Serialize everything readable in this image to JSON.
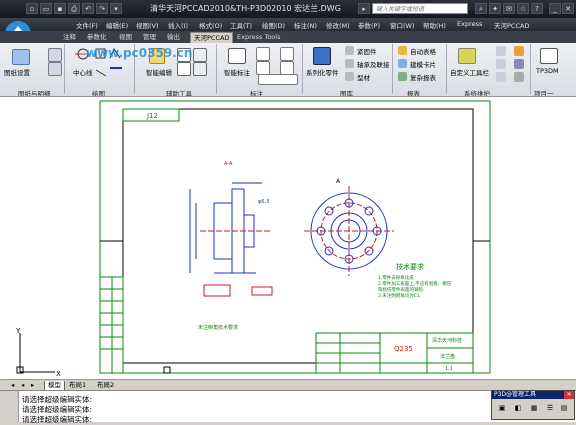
{
  "app": {
    "title": "清华天河PCCAD2010&TH-P3D02010  宏达兰.DWG",
    "search_placeholder": "键入关键字或短语"
  },
  "menus": [
    "文件(F)",
    "编辑(E)",
    "视图(V)",
    "插入(I)",
    "格式(O)",
    "工具(T)",
    "绘图(D)",
    "标注(N)",
    "修改(M)",
    "参数(P)",
    "窗口(W)",
    "帮助(H)",
    "Express",
    "天河PCCAD"
  ],
  "ribbon_tabs": [
    "注释",
    "参数化",
    "视图",
    "管理",
    "输出",
    "天河PCCAD",
    "Express Tools"
  ],
  "ribbon": {
    "tuzhi_btn": "图纸设置",
    "zhongxinxian_btn": "中心线",
    "zhineng_edit_btn": "智能编辑",
    "zhineng_dim_btn": "智能标注",
    "xilie_btn": "系列化零件",
    "gujian_label": "紧固件",
    "zhoucheng_label": "轴承及联接",
    "xingcai_label": "型材",
    "zidong_biaoge": "自动表格",
    "zhuangtu_kapian": "建模卡片",
    "fuza_biaoge": "复杂报表",
    "zidingyi_btn": "自定义工具栏",
    "tp3dm_btn": "TP3DM",
    "panels": [
      "图纸与明细",
      "绘图",
      "辅助工具",
      "标注",
      "图库",
      "报表",
      "系统维护",
      "项目一"
    ]
  },
  "watermark": "www.pc0359.cn",
  "drawing": {
    "title_code": "J12",
    "material": "Q235",
    "section_a": "A-A",
    "dim_1": "φ6.3",
    "tech_req_title": "技术要求",
    "tech_lines": [
      "1.零件去除氧化皮.",
      "2.零件加工表面上,不应有划痕、擦伤",
      "等损伤零件表面的缺陷.",
      "3.未注明倒角均为C1."
    ],
    "label_a": "A",
    "rough_label": "√",
    "axis_x": "X",
    "axis_y": "Y",
    "part_name": "法兰盘",
    "company": "清华天河科技",
    "scale": "1:1",
    "note_text": "未注倒角技术要求"
  },
  "layout_tabs": [
    "模型",
    "布局1",
    "布局2"
  ],
  "command_lines": [
    "请选择超级编辑实体:",
    "请选择超级编辑实体:",
    "请选择超级编辑实体:"
  ],
  "palette": {
    "title": "P3D@管理工具",
    "buttons": [
      "viewport-icon",
      "layer-icon",
      "grid-icon",
      "list-icon",
      "table-icon"
    ]
  },
  "colors": {
    "frame_green": "#0b8a0b",
    "part_blue": "#1d33c8",
    "hidden_red": "#c81e1e",
    "bg_ribbon": "#e4e7ec"
  }
}
